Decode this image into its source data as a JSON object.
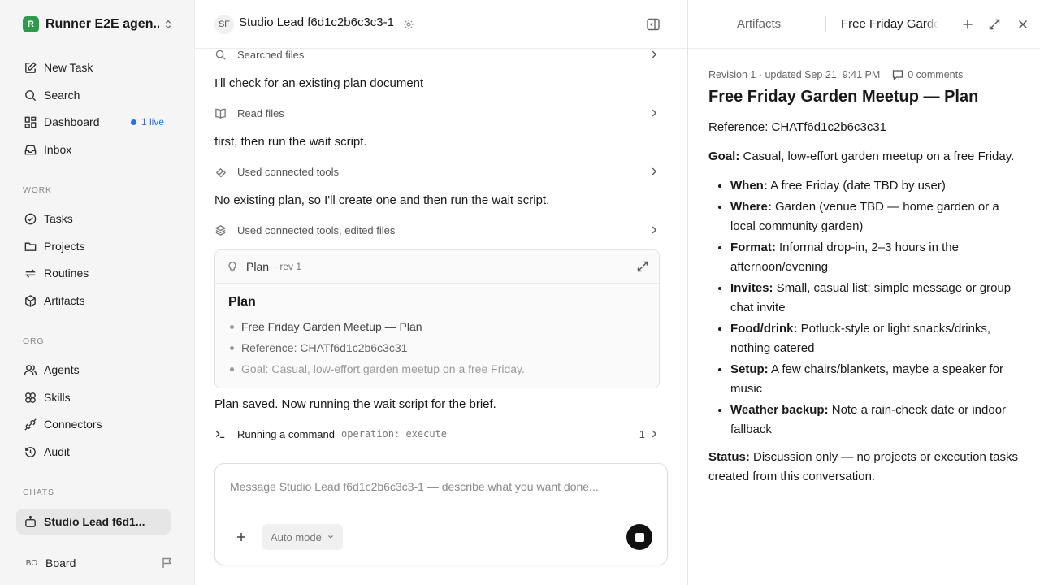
{
  "workspace": {
    "logo_letter": "R",
    "name": "Runner E2E agen..."
  },
  "sidebar": {
    "nav": [
      {
        "label": "New Task",
        "icon": "new-task-icon"
      },
      {
        "label": "Search",
        "icon": "search-icon"
      },
      {
        "label": "Dashboard",
        "icon": "dashboard-icon",
        "live_label": "1 live"
      },
      {
        "label": "Inbox",
        "icon": "inbox-icon"
      }
    ],
    "work_label": "WORK",
    "work": [
      {
        "label": "Tasks",
        "icon": "tasks-icon"
      },
      {
        "label": "Projects",
        "icon": "folder-icon"
      },
      {
        "label": "Routines",
        "icon": "routines-icon"
      },
      {
        "label": "Artifacts",
        "icon": "artifacts-icon"
      }
    ],
    "org_label": "ORG",
    "org": [
      {
        "label": "Agents",
        "icon": "agents-icon"
      },
      {
        "label": "Skills",
        "icon": "skills-icon"
      },
      {
        "label": "Connectors",
        "icon": "connectors-icon"
      },
      {
        "label": "Audit",
        "icon": "audit-icon"
      }
    ],
    "chats_label": "CHATS",
    "chats": [
      {
        "label": "Studio Lead f6d1...",
        "icon": "bot-icon"
      }
    ],
    "footer": {
      "initials": "BO",
      "name": "Board"
    }
  },
  "chat": {
    "header": {
      "initials": "SF",
      "title": "Studio Lead f6d1c2b6c3c3-1"
    },
    "steps": {
      "searched": "Searched files",
      "msg1": "I'll check for an existing plan document",
      "read": "Read files",
      "msg2": "first, then run the wait script.",
      "tools1": "Used connected tools",
      "msg3": "No existing plan, so I'll create one and then run the wait script.",
      "tools2": "Used connected tools, edited files"
    },
    "plan_card": {
      "label": "Plan",
      "rev": "· rev 1",
      "heading": "Plan",
      "items": [
        "Free Friday Garden Meetup — Plan",
        "Reference: CHATf6d1c2b6c3c31",
        "Goal: Casual, low-effort garden meetup on a free Friday."
      ]
    },
    "msg4": "Plan saved. Now running the wait script for the brief.",
    "command": {
      "label": "Running a command",
      "op": "operation: execute",
      "count": "1"
    },
    "composer": {
      "placeholder": "Message Studio Lead f6d1c2b6c3c3-1 — describe what you want done...",
      "mode": "Auto mode"
    }
  },
  "artifact": {
    "tabs": {
      "artifacts": "Artifacts",
      "doc": "Free Friday Garden Meetup — Plan"
    },
    "meta": "Revision 1 · updated Sep 21, 9:41 PM",
    "comments": "0 comments",
    "title": "Free Friday Garden Meetup — Plan",
    "reference": "Reference: CHATf6d1c2b6c3c31",
    "goal_label": "Goal:",
    "goal_text": " Casual, low-effort garden meetup on a free Friday.",
    "bullets": [
      {
        "k": "When:",
        "v": " A free Friday (date TBD by user)"
      },
      {
        "k": "Where:",
        "v": " Garden (venue TBD — home garden or a local community garden)"
      },
      {
        "k": "Format:",
        "v": " Informal drop-in, 2–3 hours in the afternoon/evening"
      },
      {
        "k": "Invites:",
        "v": " Small, casual list; simple message or group chat invite"
      },
      {
        "k": "Food/drink:",
        "v": " Potluck-style or light snacks/drinks, nothing catered"
      },
      {
        "k": "Setup:",
        "v": " A few chairs/blankets, maybe a speaker for music"
      },
      {
        "k": "Weather backup:",
        "v": " Note a rain-check date or indoor fallback"
      }
    ],
    "status_label": "Status:",
    "status_text": " Discussion only — no projects or execution tasks created from this conversation."
  }
}
